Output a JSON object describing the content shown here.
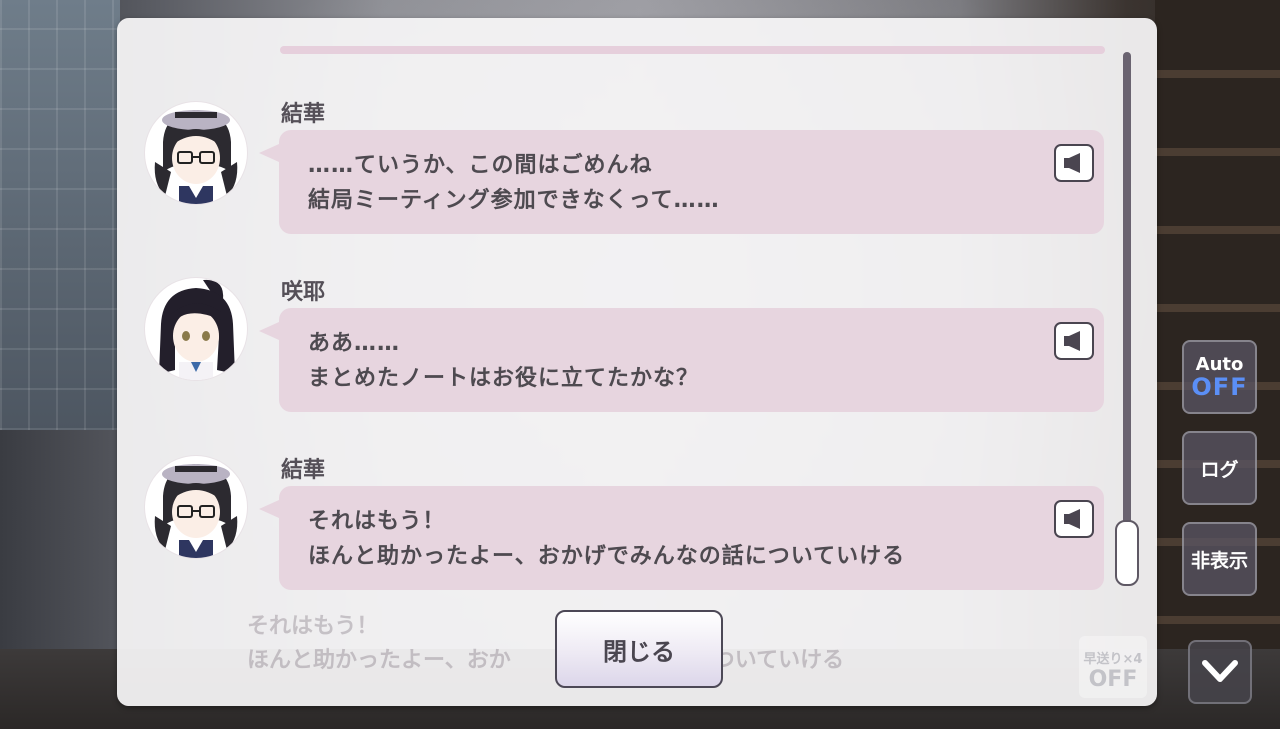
{
  "log": {
    "entries": [
      {
        "speaker": "結華",
        "lines": [
          "……ていうか、この間はごめんね",
          "結局ミーティング参加できなくって……"
        ]
      },
      {
        "speaker": "咲耶",
        "lines": [
          "ああ……",
          "まとめたノートはお役に立てたかな？"
        ]
      },
      {
        "speaker": "結華",
        "lines": [
          "それはもう！",
          "ほんと助かったよー、おかげでみんなの話についていける"
        ]
      }
    ],
    "close_label": "閉じる",
    "background_text": {
      "line1": "それはもう！",
      "line2": "ほんと助かったよー、おか",
      "line2_tail": "についていける",
      "ff_label": "早送り×4",
      "ff_state": "OFF"
    }
  },
  "controls": {
    "auto_label": "Auto",
    "auto_state": "OFF",
    "log_label": "ログ",
    "hide_label": "非表示"
  },
  "colors": {
    "bubble": "#e7d5df",
    "text": "#4e4a50",
    "auto_off": "#5b8ff6"
  }
}
